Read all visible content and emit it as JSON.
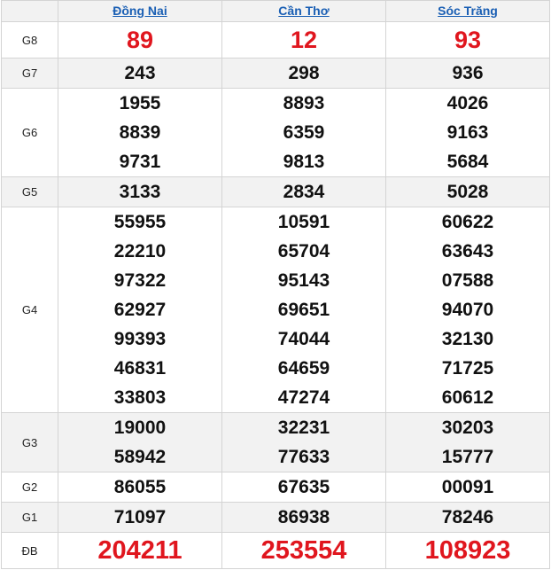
{
  "provinces": [
    "Đồng Nai",
    "Cần Thơ",
    "Sóc Trăng"
  ],
  "colors": {
    "special": "#e0161e",
    "link": "#1a5fb4",
    "shade": "#f2f2f2"
  },
  "prizes": [
    {
      "label": "G8",
      "shade": false,
      "style": "red",
      "values": [
        [
          "89"
        ],
        [
          "12"
        ],
        [
          "93"
        ]
      ]
    },
    {
      "label": "G7",
      "shade": true,
      "style": "",
      "values": [
        [
          "243"
        ],
        [
          "298"
        ],
        [
          "936"
        ]
      ]
    },
    {
      "label": "G6",
      "shade": false,
      "style": "",
      "values": [
        [
          "1955",
          "8839",
          "9731"
        ],
        [
          "8893",
          "6359",
          "9813"
        ],
        [
          "4026",
          "9163",
          "5684"
        ]
      ]
    },
    {
      "label": "G5",
      "shade": true,
      "style": "",
      "values": [
        [
          "3133"
        ],
        [
          "2834"
        ],
        [
          "5028"
        ]
      ]
    },
    {
      "label": "G4",
      "shade": false,
      "style": "",
      "values": [
        [
          "55955",
          "22210",
          "97322",
          "62927",
          "99393",
          "46831",
          "33803"
        ],
        [
          "10591",
          "65704",
          "95143",
          "69651",
          "74044",
          "64659",
          "47274"
        ],
        [
          "60622",
          "63643",
          "07588",
          "94070",
          "32130",
          "71725",
          "60612"
        ]
      ]
    },
    {
      "label": "G3",
      "shade": true,
      "style": "",
      "values": [
        [
          "19000",
          "58942"
        ],
        [
          "32231",
          "77633"
        ],
        [
          "30203",
          "15777"
        ]
      ]
    },
    {
      "label": "G2",
      "shade": false,
      "style": "",
      "values": [
        [
          "86055"
        ],
        [
          "67635"
        ],
        [
          "00091"
        ]
      ]
    },
    {
      "label": "G1",
      "shade": true,
      "style": "",
      "values": [
        [
          "71097"
        ],
        [
          "86938"
        ],
        [
          "78246"
        ]
      ]
    },
    {
      "label": "ĐB",
      "shade": false,
      "style": "db",
      "values": [
        [
          "204211"
        ],
        [
          "253554"
        ],
        [
          "108923"
        ]
      ]
    }
  ]
}
